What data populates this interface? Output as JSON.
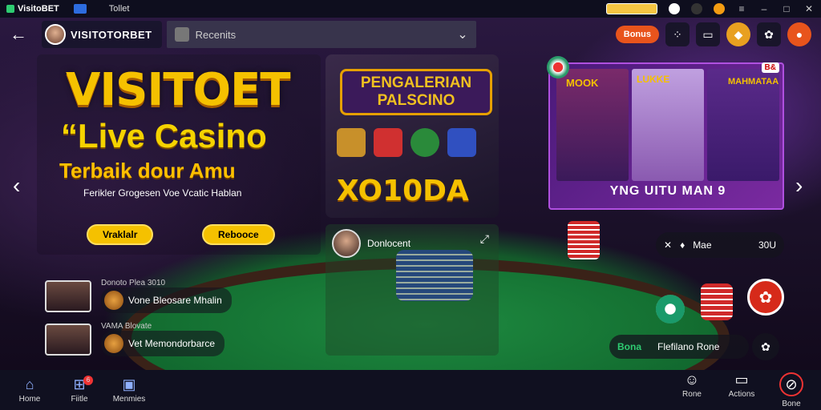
{
  "sysbar": {
    "app_name": "VisitoBET",
    "window_title": "Tollet"
  },
  "header": {
    "brand": "VISITOTORBET",
    "search_text": "Recenits",
    "promo_pill": "Bonus"
  },
  "hero": {
    "logo": "VISITOET",
    "headline": "“Live Casino",
    "subheadline": "Terbaik dour Amu",
    "tagline": "Ferikler Grogesen Voe Vcatic Hablan",
    "btn_left": "Vraklalr",
    "btn_right": "Rebooce"
  },
  "promo": {
    "title": "PENGALERIAN PALSCINO",
    "big": "XO10DA"
  },
  "banner": {
    "card1": "MOOK",
    "card2": "LUKKE",
    "card3": "MAHMATAA",
    "badge": "B&",
    "caption": "YNG UITU MAN 9"
  },
  "live": {
    "dealer": "Donlocent"
  },
  "players": [
    {
      "name": "Donoto Plea",
      "stat": "3010",
      "game": "Vone Bleosare Mhalin"
    },
    {
      "name": "VAMA",
      "stat": "Blovate",
      "game": "Vet Memondorbarce"
    }
  ],
  "controls": {
    "mode": "Mae",
    "count": "30U",
    "bet_label": "Bona",
    "bet_value": "Flefilano Rone"
  },
  "nav": {
    "left": [
      {
        "label": "Home",
        "icon": "home-icon"
      },
      {
        "label": "Fiitle",
        "icon": "gift-icon",
        "badge": "6"
      },
      {
        "label": "Menmies",
        "icon": "menu-icon"
      }
    ],
    "right": [
      {
        "label": "Rone",
        "icon": "person-icon"
      },
      {
        "label": "Actions",
        "icon": "laptop-icon"
      },
      {
        "label": "Bone",
        "icon": "close-icon"
      }
    ]
  }
}
